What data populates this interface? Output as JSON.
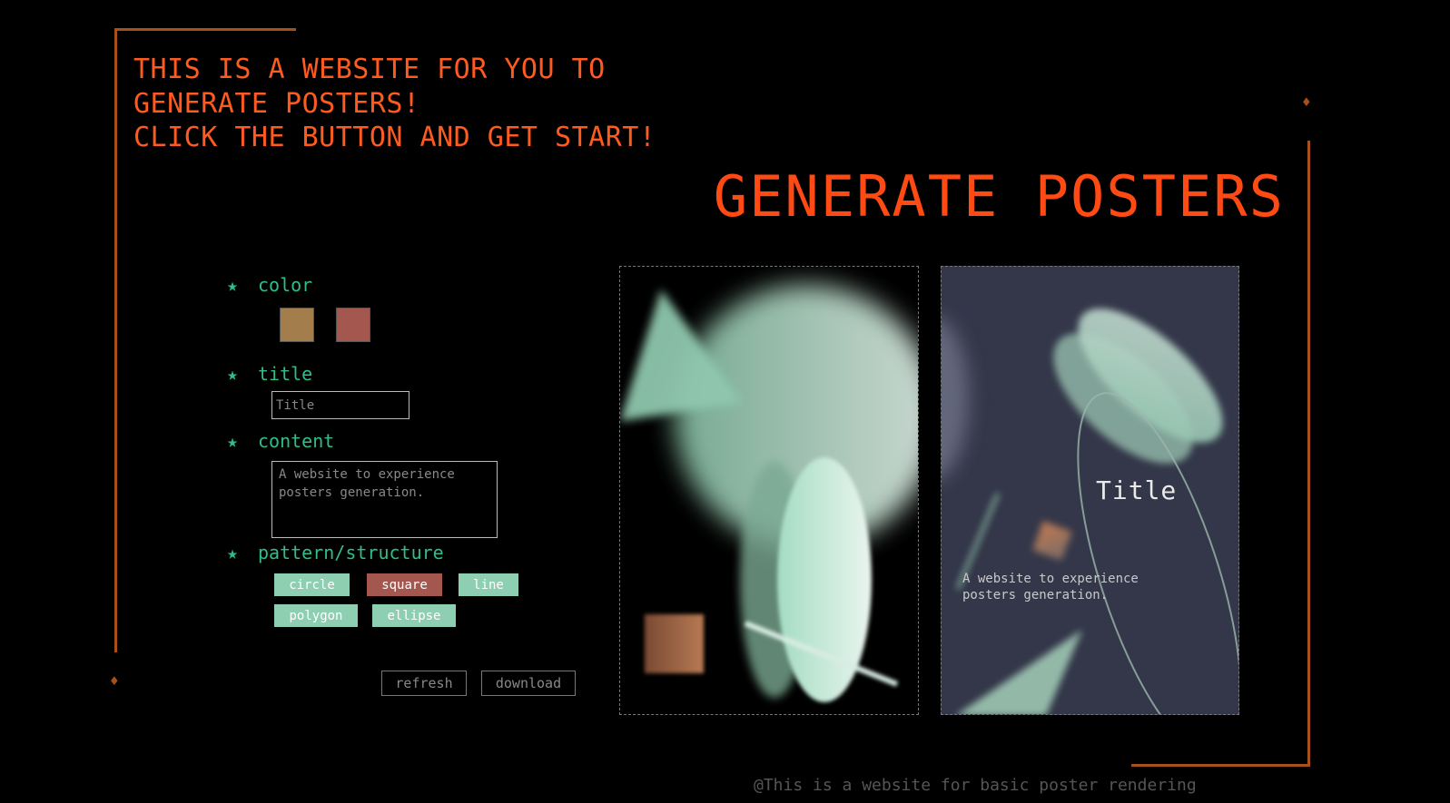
{
  "intro": {
    "lines": [
      "THIS IS A WEBSITE FOR YOU TO",
      "GENERATE POSTERS!",
      "CLICK THE BUTTON AND GET START!"
    ]
  },
  "header": {
    "title": "GENERATE POSTERS"
  },
  "colors": {
    "accent": "#ff4a14",
    "frame": "#a8501c",
    "label": "#2fbf86"
  },
  "form": {
    "color": {
      "label": "color",
      "swatches": [
        "#a37d4c",
        "#a3574f"
      ]
    },
    "title": {
      "label": "title",
      "placeholder": "Title"
    },
    "content": {
      "label": "content",
      "placeholder": "A website to experience posters generation."
    },
    "pattern": {
      "label": "pattern/structure",
      "options": [
        {
          "label": "circle",
          "color": "#8fcfb1"
        },
        {
          "label": "square",
          "color": "#a3574f"
        },
        {
          "label": "line",
          "color": "#8fcfb1"
        },
        {
          "label": "polygon",
          "color": "#8fcfb1"
        },
        {
          "label": "ellipse",
          "color": "#8fcfb1"
        }
      ]
    },
    "actions": {
      "refresh": "refresh",
      "download": "download"
    }
  },
  "posters": {
    "second": {
      "title": "Title",
      "text": "A website to experience posters generation."
    }
  },
  "footer": {
    "text": "@This is a website for basic poster rendering"
  },
  "icons": {
    "star": "star-icon",
    "diamond": "diamond-icon"
  }
}
